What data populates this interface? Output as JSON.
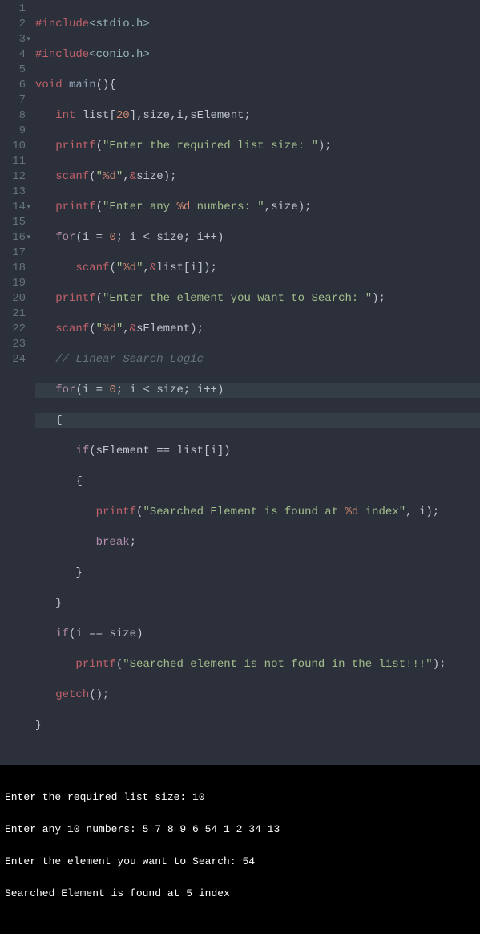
{
  "gutter": {
    "lines": [
      "1",
      "2",
      "3",
      "4",
      "5",
      "6",
      "7",
      "8",
      "9",
      "10",
      "11",
      "12",
      "13",
      "14",
      "15",
      "16",
      "17",
      "18",
      "19",
      "20",
      "21",
      "22",
      "23",
      "24"
    ],
    "fold_markers": {
      "3": "▾",
      "14": "▾",
      "16": "▾"
    },
    "highlighted": [
      13,
      14
    ]
  },
  "code": {
    "l1": {
      "include": "#include",
      "header": "<stdio.h>"
    },
    "l2": {
      "include": "#include",
      "header": "<conio.h>"
    },
    "l3": {
      "kw_void": "void",
      "fn": "main",
      "paren": "(){"
    },
    "l4": {
      "indent": "   ",
      "kw_int": "int",
      "decl": " list[",
      "num20": "20",
      "rest": "],size,i,sElement;"
    },
    "l5": {
      "indent": "   ",
      "fn": "printf",
      "open": "(",
      "str_a": "\"Enter the required list size: \"",
      "close": ");"
    },
    "l6": {
      "indent": "   ",
      "fn": "scanf",
      "open": "(",
      "str_a": "\"",
      "fmt": "%d",
      "str_b": "\"",
      "comma": ",",
      "amp": "&",
      "var": "size",
      "close": ");"
    },
    "l7": {
      "indent": "   ",
      "fn": "printf",
      "open": "(",
      "str_a": "\"Enter any ",
      "fmt": "%d",
      "str_b": " numbers: \"",
      "comma": ",",
      "var": "size",
      "close": ");"
    },
    "l8": {
      "indent": "   ",
      "kw_for": "for",
      "open": "(",
      "var_i": "i",
      "eq": " = ",
      "zero": "0",
      "semi1": "; ",
      "var_i2": "i",
      "lt": " < ",
      "var_size": "size",
      "semi2": "; ",
      "var_i3": "i",
      "inc": "++",
      "close": ")"
    },
    "l9": {
      "indent": "      ",
      "fn": "scanf",
      "open": "(",
      "str_a": "\"",
      "fmt": "%d",
      "str_b": "\"",
      "comma": ",",
      "amp": "&",
      "var": "list[i]",
      "close": ");"
    },
    "l10": {
      "indent": "   ",
      "fn": "printf",
      "open": "(",
      "str_a": "\"Enter the element you want to Search: \"",
      "close": ");"
    },
    "l11": {
      "indent": "   ",
      "fn": "scanf",
      "open": "(",
      "str_a": "\"",
      "fmt": "%d",
      "str_b": "\"",
      "comma": ",",
      "amp": "&",
      "var": "sElement",
      "close": ");"
    },
    "l12": {
      "indent": "   ",
      "comment": "// Linear Search Logic"
    },
    "l13": {
      "indent": "   ",
      "kw_for": "for",
      "open": "(",
      "var_i": "i",
      "eq": " = ",
      "zero": "0",
      "semi1": "; ",
      "var_i2": "i",
      "lt": " < ",
      "var_size": "size",
      "semi2": "; ",
      "var_i3": "i",
      "inc": "++",
      "close": ")"
    },
    "l14": {
      "indent": "   ",
      "brace": "{"
    },
    "l15": {
      "indent": "      ",
      "kw_if": "if",
      "open": "(",
      "var_a": "sElement",
      "eq": " == ",
      "var_b": "list[i]",
      "close": ")"
    },
    "l16": {
      "indent": "      ",
      "brace": "{"
    },
    "l17": {
      "indent": "         ",
      "fn": "printf",
      "open": "(",
      "str_a": "\"Searched Element is found at ",
      "fmt": "%d",
      "str_b": " index\"",
      "comma": ", ",
      "var": "i",
      "close": ");"
    },
    "l18": {
      "indent": "         ",
      "kw_break": "break",
      "semi": ";"
    },
    "l19": {
      "indent": "      ",
      "brace": "}"
    },
    "l20": {
      "indent": "   ",
      "brace": "}"
    },
    "l21": {
      "indent": "   ",
      "kw_if": "if",
      "open": "(",
      "var_a": "i",
      "eq": " == ",
      "var_b": "size",
      "close": ")"
    },
    "l22": {
      "indent": "      ",
      "fn": "printf",
      "open": "(",
      "str_a": "\"Searched element is not found in the list!!!\"",
      "close": ");"
    },
    "l23": {
      "indent": "   ",
      "fn": "getch",
      "open": "(",
      "close": ");"
    },
    "l24": {
      "brace": "}"
    }
  },
  "console": {
    "l1": "Enter the required list size: 10",
    "l2": "Enter any 10 numbers: 5 7 8 9 6 54 1 2 34 13",
    "l3": "Enter the element you want to Search: 54",
    "l4": "Searched Element is found at 5 index"
  }
}
